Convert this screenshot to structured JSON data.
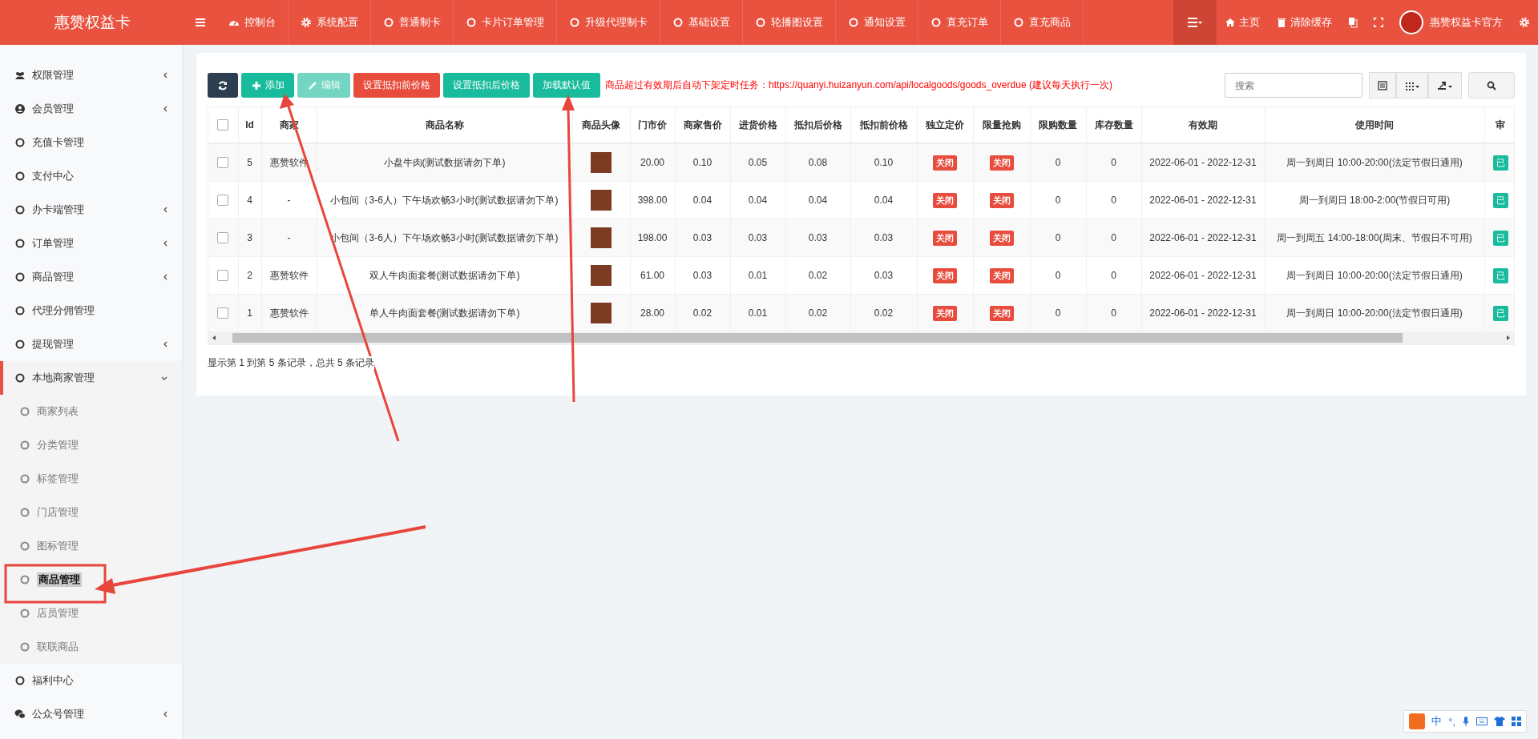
{
  "header": {
    "brand": "惠赞权益卡",
    "nav": [
      {
        "label": "控制台",
        "kind": "dashboard"
      },
      {
        "label": "系统配置",
        "kind": "gear"
      },
      {
        "label": "普通制卡",
        "kind": "circle"
      },
      {
        "label": "卡片订单管理",
        "kind": "circle"
      },
      {
        "label": "升级代理制卡",
        "kind": "circle"
      },
      {
        "label": "基础设置",
        "kind": "circle"
      },
      {
        "label": "轮播图设置",
        "kind": "circle"
      },
      {
        "label": "通知设置",
        "kind": "circle"
      },
      {
        "label": "直充订单",
        "kind": "circle"
      },
      {
        "label": "直充商品",
        "kind": "circle"
      }
    ],
    "right": [
      {
        "label": "主页",
        "kind": "home"
      },
      {
        "label": "清除缓存",
        "kind": "trash"
      }
    ],
    "user": "惠赞权益卡官方"
  },
  "sidebar": {
    "items": [
      {
        "label": "权限管理",
        "kind": "users",
        "expanded": false,
        "selected": false
      },
      {
        "label": "会员管理",
        "kind": "user",
        "expanded": false,
        "selected": false
      },
      {
        "label": "充值卡管理",
        "kind": "circle",
        "selected": false
      },
      {
        "label": "支付中心",
        "kind": "circle",
        "selected": false
      },
      {
        "label": "办卡端管理",
        "kind": "circle",
        "expanded": false,
        "selected": false
      },
      {
        "label": "订单管理",
        "kind": "circle",
        "expanded": false,
        "selected": false
      },
      {
        "label": "商品管理",
        "kind": "circle",
        "expanded": false,
        "selected": false
      },
      {
        "label": "代理分佣管理",
        "kind": "circle",
        "selected": false
      },
      {
        "label": "提现管理",
        "kind": "circle",
        "expanded": false,
        "selected": false
      },
      {
        "label": "本地商家管理",
        "kind": "circle",
        "expanded": true,
        "selected": true,
        "children": [
          {
            "label": "商家列表",
            "selected": false
          },
          {
            "label": "分类管理",
            "selected": false
          },
          {
            "label": "标签管理",
            "selected": false
          },
          {
            "label": "门店管理",
            "selected": false
          },
          {
            "label": "图标管理",
            "selected": false
          },
          {
            "label": "商品管理",
            "selected": true
          },
          {
            "label": "店员管理",
            "selected": false
          },
          {
            "label": "联联商品",
            "selected": false
          }
        ]
      },
      {
        "label": "福利中心",
        "kind": "circle",
        "selected": false
      },
      {
        "label": "公众号管理",
        "kind": "wechat",
        "expanded": false,
        "selected": false
      }
    ]
  },
  "toolbar": {
    "buttons": [
      {
        "kind": "refresh",
        "color": "#2c3e50",
        "disabled": false
      },
      {
        "label": "添加",
        "kind": "plus",
        "color": "#18bc9c",
        "disabled": false
      },
      {
        "label": "编辑",
        "kind": "pencil",
        "color": "#74d5c2",
        "disabled": true
      },
      {
        "label": "设置抵扣前价格",
        "kind": "text",
        "color": "#e74c3c",
        "disabled": false
      },
      {
        "label": "设置抵扣后价格",
        "kind": "text",
        "color": "#18bc9c",
        "disabled": false
      },
      {
        "label": "加载默认值",
        "kind": "text",
        "color": "#18bc9c",
        "disabled": false
      }
    ],
    "notice": "商品超过有效期后自动下架定时任务：https://quanyi.huizanyun.com/api/localgoods/goods_overdue (建议每天执行一次)",
    "search": {
      "placeholder": "搜索"
    }
  },
  "table": {
    "header_checked": false,
    "columns": [
      "Id",
      "商家",
      "商品名称",
      "商品头像",
      "门市价",
      "商家售价",
      "进货价格",
      "抵扣后价格",
      "抵扣前价格",
      "独立定价",
      "限量抢购",
      "限购数量",
      "库存数量",
      "有效期",
      "使用时间",
      "审"
    ],
    "rows": [
      {
        "checked": false,
        "cells": [
          "5",
          "惠赞软件",
          "小盘牛肉(测试数据请勿下单)",
          {
            "kind": "photo"
          },
          "20.00",
          "0.10",
          "0.05",
          "0.08",
          "0.10",
          {
            "kind": "toggle",
            "text": "关闭",
            "on": false
          },
          {
            "kind": "toggle",
            "text": "关闭",
            "on": false
          },
          "0",
          "0",
          "2022-06-01 - 2022-12-31",
          "周一到周日 10:00-20:00(法定节假日通用)",
          {
            "kind": "badge",
            "text": "已"
          }
        ]
      },
      {
        "checked": false,
        "cells": [
          "4",
          "-",
          "小包间（3-6人）下午场欢畅3小时(测试数据请勿下单)",
          {
            "kind": "photo"
          },
          "398.00",
          "0.04",
          "0.04",
          "0.04",
          "0.04",
          {
            "kind": "toggle",
            "text": "关闭",
            "on": false
          },
          {
            "kind": "toggle",
            "text": "关闭",
            "on": false
          },
          "0",
          "0",
          "2022-06-01 - 2022-12-31",
          "周一到周日 18:00-2:00(节假日可用)",
          {
            "kind": "badge",
            "text": "已"
          }
        ]
      },
      {
        "checked": false,
        "cells": [
          "3",
          "-",
          "小包间（3-6人）下午场欢畅3小时(测试数据请勿下单)",
          {
            "kind": "photo"
          },
          "198.00",
          "0.03",
          "0.03",
          "0.03",
          "0.03",
          {
            "kind": "toggle",
            "text": "关闭",
            "on": false
          },
          {
            "kind": "toggle",
            "text": "关闭",
            "on": false
          },
          "0",
          "0",
          "2022-06-01 - 2022-12-31",
          "周一到周五 14:00-18:00(周末、节假日不可用)",
          {
            "kind": "badge",
            "text": "已"
          }
        ]
      },
      {
        "checked": false,
        "cells": [
          "2",
          "惠赞软件",
          "双人牛肉面套餐(测试数据请勿下单)",
          {
            "kind": "photo"
          },
          "61.00",
          "0.03",
          "0.01",
          "0.02",
          "0.03",
          {
            "kind": "toggle",
            "text": "关闭",
            "on": false
          },
          {
            "kind": "toggle",
            "text": "关闭",
            "on": false
          },
          "0",
          "0",
          "2022-06-01 - 2022-12-31",
          "周一到周日 10:00-20:00(法定节假日通用)",
          {
            "kind": "badge",
            "text": "已"
          }
        ]
      },
      {
        "checked": false,
        "cells": [
          "1",
          "惠赞软件",
          "单人牛肉面套餐(测试数据请勿下单)",
          {
            "kind": "photo"
          },
          "28.00",
          "0.02",
          "0.01",
          "0.02",
          "0.02",
          {
            "kind": "toggle",
            "text": "关闭",
            "on": false
          },
          {
            "kind": "toggle",
            "text": "关闭",
            "on": false
          },
          "0",
          "0",
          "2022-06-01 - 2022-12-31",
          "周一到周日 10:00-20:00(法定节假日通用)",
          {
            "kind": "badge",
            "text": "已"
          }
        ]
      }
    ],
    "summary": "显示第 1 到第 5 条记录，总共 5 条记录"
  },
  "ime": {
    "labels": [
      "中",
      "°,"
    ]
  }
}
